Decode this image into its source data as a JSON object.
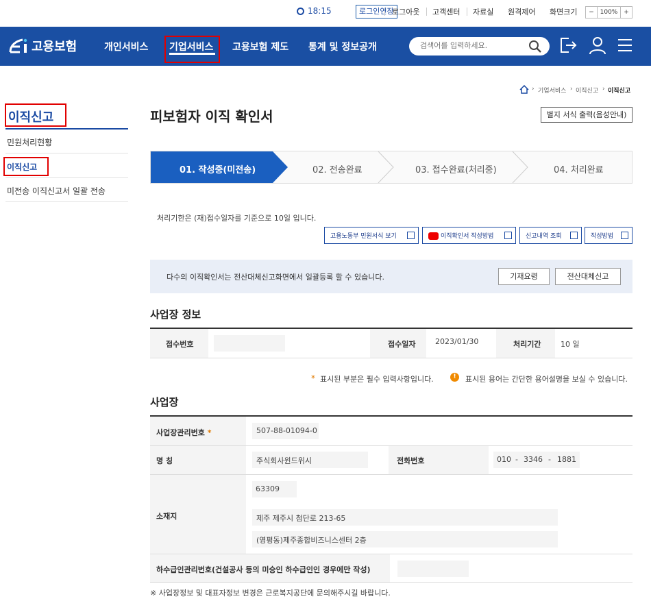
{
  "util": {
    "time": "18:15",
    "extend_login": "로그인연장",
    "links": [
      "로그아웃",
      "고객센터",
      "자료실",
      "원격제어",
      "화면크기"
    ],
    "zoom_minus": "−",
    "zoom_value": "100%",
    "zoom_plus": "+"
  },
  "header": {
    "logo_text": "고용보험",
    "nav": [
      "개인서비스",
      "기업서비스",
      "고용보험 제도",
      "통계 및 정보공개"
    ],
    "search_placeholder": "검색어를 입력하세요."
  },
  "colors": {
    "primary": "#1a4fa3",
    "step_active": "#1a5fc0",
    "highlight_box": "#e10000",
    "required": "#e07a00"
  },
  "sidebar": {
    "title": "이직신고",
    "items": [
      "민원처리현황",
      "이직신고",
      "미전송 이직신고서 일괄 전송"
    ]
  },
  "breadcrumb": {
    "home_icon": "home-icon",
    "items": [
      "기업서비스",
      "이직신고",
      "이직신고"
    ]
  },
  "page": {
    "title": "피보험자 이직 확인서",
    "print_button": "별지 서식 출력(음성안내)"
  },
  "steps": [
    "01. 작성중(미전송)",
    "02. 전송완료",
    "03. 접수완료(처리중)",
    "04. 처리완료"
  ],
  "processing_limit": "처리기한은 (재)접수일자를 기준으로 10일 입니다.",
  "link_buttons": [
    "고용노동부 민원서식 보기",
    "이직확인서 작성방법",
    "신고내역 조회",
    "작성방법"
  ],
  "notice": {
    "text": "다수의 이직확인서는 전산대체신고화면에서 일괄등록 할 수 있습니다.",
    "btn_guide": "기재요령",
    "btn_batch": "전산대체신고"
  },
  "workplace_info": {
    "section_title": "사업장 정보",
    "receipt_no_label": "접수번호",
    "receipt_no": "",
    "receipt_date_label": "접수일자",
    "receipt_date": "2023/01/30",
    "period_label": "처리기간",
    "period": "10 일"
  },
  "legend": {
    "required_mark": "*",
    "required_text": "표시된 부분은 필수 입력사항입니다.",
    "info_mark": "!",
    "info_text": "표시된 용어는 간단한 용어설명을 보실 수 있습니다."
  },
  "workplace": {
    "section_title": "사업장",
    "mgmt_no_label": "사업장관리번호",
    "mgmt_no": "507-88-01094-0",
    "name_label": "명 칭",
    "name": "주식회사윈드위시",
    "phone_label": "전화번호",
    "phone": [
      "010",
      "3346",
      "1881"
    ],
    "address_label": "소재지",
    "zip": "63309",
    "address1": "제주 제주시 첨단로 213-65",
    "address2": "(영평동)제주종합비즈니스센터 2층",
    "sub_label": "하수급인관리번호(건설공사 등의 미승인 하수급인인 경우에만 작성)",
    "sub_value": ""
  },
  "footnote": "※ 사업장정보 및 대표자정보 변경은 근로복지공단에 문의해주시길 바랍니다."
}
